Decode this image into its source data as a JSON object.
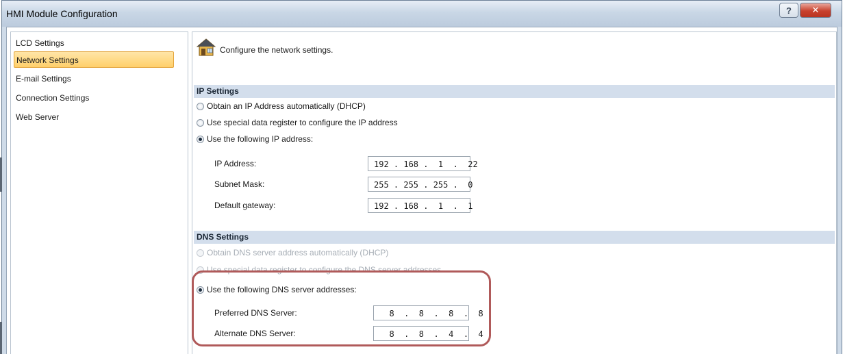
{
  "window": {
    "title": "HMI Module Configuration",
    "help_label": "?",
    "close_label": "✕"
  },
  "sidebar": {
    "items": [
      {
        "label": "LCD Settings",
        "selected": false
      },
      {
        "label": "Network Settings",
        "selected": true
      },
      {
        "label": "E-mail Settings",
        "selected": false
      },
      {
        "label": "Connection Settings",
        "selected": false
      },
      {
        "label": "Web Server",
        "selected": false
      }
    ]
  },
  "main": {
    "icon": "house-network-icon",
    "intro": "Configure the network settings.",
    "ip_settings": {
      "header": "IP Settings",
      "options": [
        {
          "label": "Obtain an IP Address automatically (DHCP)",
          "checked": false
        },
        {
          "label": "Use special data register to configure the IP address",
          "checked": false
        },
        {
          "label": "Use the following IP address:",
          "checked": true
        }
      ],
      "fields": [
        {
          "label": "IP Address:",
          "value": "192 . 168 .  1  .  22"
        },
        {
          "label": "Subnet Mask:",
          "value": "255 . 255 . 255 .  0"
        },
        {
          "label": "Default gateway:",
          "value": "192 . 168 .  1  .  1"
        }
      ]
    },
    "dns_settings": {
      "header": "DNS Settings",
      "options": [
        {
          "label": "Obtain DNS server address automatically (DHCP)",
          "checked": false,
          "disabled": true
        },
        {
          "label": "Use special data register to configure the DNS server addresses",
          "checked": false,
          "disabled": true
        },
        {
          "label": "Use the following DNS server addresses:",
          "checked": true,
          "disabled": false
        }
      ],
      "fields": [
        {
          "label": "Preferred DNS Server:",
          "value": "  8  .  8  .  8  .  8"
        },
        {
          "label": "Alternate DNS Server:",
          "value": "  8  .  8  .  4  .  4"
        }
      ]
    }
  },
  "colors": {
    "selection": "#ffcf6a",
    "section_header": "#d3deec",
    "highlight_outline": "#b05a5a"
  }
}
